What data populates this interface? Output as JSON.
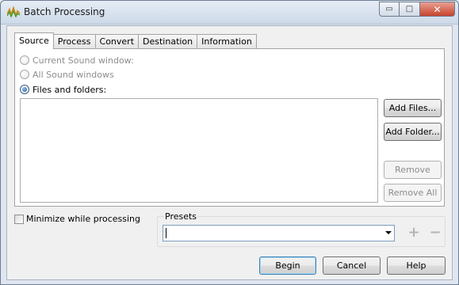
{
  "window": {
    "title": "Batch Processing",
    "caption_buttons": {
      "minimize": "▭",
      "maximize": "□",
      "close": "✕"
    }
  },
  "tabs": [
    {
      "label": "Source",
      "active": true
    },
    {
      "label": "Process",
      "active": false
    },
    {
      "label": "Convert",
      "active": false
    },
    {
      "label": "Destination",
      "active": false
    },
    {
      "label": "Information",
      "active": false
    }
  ],
  "source": {
    "options": [
      {
        "label": "Current Sound window:",
        "enabled": false,
        "checked": false
      },
      {
        "label": "All Sound windows",
        "enabled": false,
        "checked": false
      },
      {
        "label": "Files and folders:",
        "enabled": true,
        "checked": true
      }
    ],
    "buttons": {
      "add_files": "Add Files...",
      "add_folder": "Add Folder...",
      "remove": "Remove",
      "remove_all": "Remove All"
    }
  },
  "minimize_while_processing": {
    "label": "Minimize while processing",
    "checked": false
  },
  "presets": {
    "label": "Presets",
    "value": "",
    "add_icon": "plus-icon",
    "remove_icon": "minus-icon"
  },
  "footer": {
    "begin": "Begin",
    "cancel": "Cancel",
    "help": "Help"
  },
  "colors": {
    "accent_default_button": "#3c7fb1",
    "disabled_text": "#8d8d8d"
  }
}
